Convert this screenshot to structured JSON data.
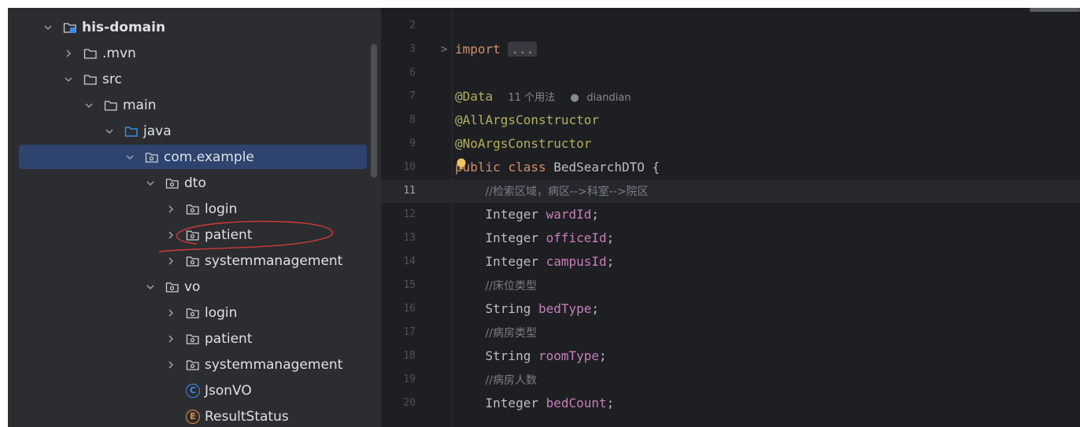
{
  "tree": {
    "items": [
      {
        "label": "his-domain",
        "kind": "module",
        "expanded": true
      },
      {
        "label": ".mvn",
        "kind": "folder",
        "expanded": false
      },
      {
        "label": "src",
        "kind": "folder",
        "expanded": true
      },
      {
        "label": "main",
        "kind": "folder",
        "expanded": true
      },
      {
        "label": "java",
        "kind": "source-folder",
        "expanded": true
      },
      {
        "label": "com.example",
        "kind": "package",
        "expanded": true,
        "selected": true
      },
      {
        "label": "dto",
        "kind": "package",
        "expanded": true
      },
      {
        "label": "login",
        "kind": "package",
        "expanded": false
      },
      {
        "label": "patient",
        "kind": "package",
        "expanded": false
      },
      {
        "label": "systemmanagement",
        "kind": "package",
        "expanded": false
      },
      {
        "label": "vo",
        "kind": "package",
        "expanded": true
      },
      {
        "label": "login",
        "kind": "package",
        "expanded": false
      },
      {
        "label": "patient",
        "kind": "package",
        "expanded": false
      },
      {
        "label": "systemmanagement",
        "kind": "package",
        "expanded": false
      },
      {
        "label": "JsonVO",
        "kind": "class",
        "badge": "C"
      },
      {
        "label": "ResultStatus",
        "kind": "enum",
        "badge": "E"
      }
    ]
  },
  "editor": {
    "lines": [
      {
        "num": "2"
      },
      {
        "num": "3",
        "import_kw": "import",
        "folded": "..."
      },
      {
        "num": "6"
      },
      {
        "num": "7",
        "annotation": "@Data",
        "usages": "11 个用法",
        "author": "diandian"
      },
      {
        "num": "8",
        "annotation": "@AllArgsConstructor"
      },
      {
        "num": "9",
        "annotation": "@NoArgsConstructor"
      },
      {
        "num": "10",
        "kw1": "public",
        "kw2": "class",
        "name": "BedSearchDTO {"
      },
      {
        "num": "11",
        "comment": "//检索区域，病区-->科室-->院区"
      },
      {
        "num": "12",
        "type": "Integer",
        "field": "wardId"
      },
      {
        "num": "13",
        "type": "Integer",
        "field": "officeId"
      },
      {
        "num": "14",
        "type": "Integer",
        "field": "campusId"
      },
      {
        "num": "15",
        "comment": "//床位类型"
      },
      {
        "num": "16",
        "type": "String",
        "field": "bedType"
      },
      {
        "num": "17",
        "comment": "//病房类型"
      },
      {
        "num": "18",
        "type": "String",
        "field": "roomType"
      },
      {
        "num": "19",
        "comment": "//病房人数"
      },
      {
        "num": "20",
        "type": "Integer",
        "field": "bedCount"
      }
    ],
    "current_line": "11"
  }
}
